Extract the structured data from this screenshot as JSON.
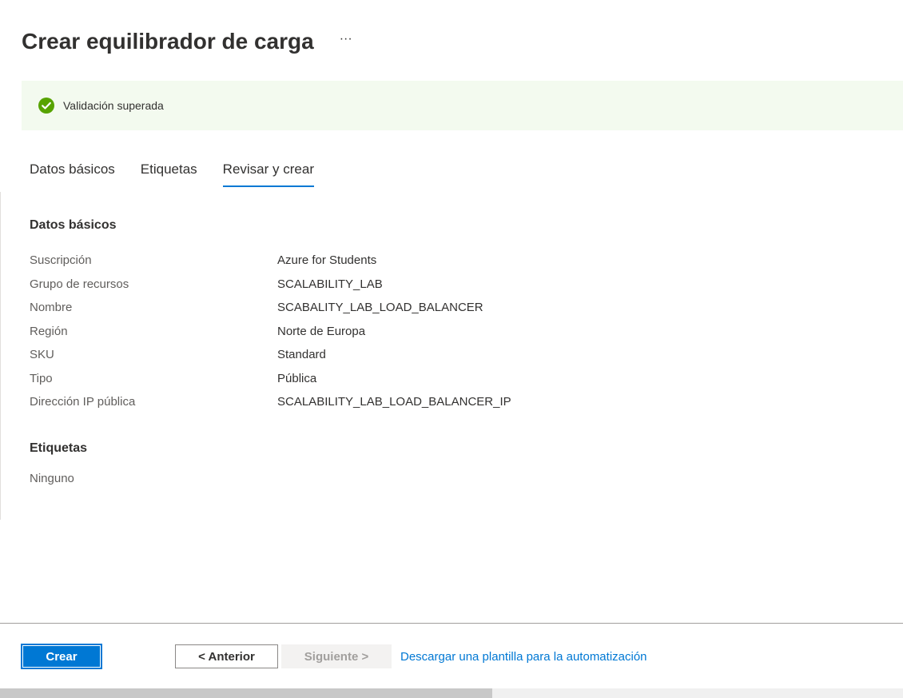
{
  "header": {
    "title": "Crear equilibrador de carga",
    "more_label": "···"
  },
  "banner": {
    "icon": "check-circle-icon",
    "text": "Validación superada",
    "color": "#57a300"
  },
  "tabs": [
    {
      "label": "Datos básicos",
      "active": false
    },
    {
      "label": "Etiquetas",
      "active": false
    },
    {
      "label": "Revisar y crear",
      "active": true
    }
  ],
  "basics": {
    "title": "Datos básicos",
    "rows": [
      {
        "label": "Suscripción",
        "value": "Azure for Students"
      },
      {
        "label": "Grupo de recursos",
        "value": "SCALABILITY_LAB"
      },
      {
        "label": "Nombre",
        "value": "SCABALITY_LAB_LOAD_BALANCER"
      },
      {
        "label": "Región",
        "value": "Norte de Europa"
      },
      {
        "label": "SKU",
        "value": "Standard"
      },
      {
        "label": "Tipo",
        "value": "Pública"
      },
      {
        "label": "Dirección IP pública",
        "value": "SCALABILITY_LAB_LOAD_BALANCER_IP"
      }
    ]
  },
  "tags": {
    "title": "Etiquetas",
    "none_text": "Ninguno"
  },
  "footer": {
    "create_label": "Crear",
    "previous_label": "< Anterior",
    "next_label": "Siguiente >",
    "download_link": "Descargar una plantilla para la automatización"
  },
  "colors": {
    "accent": "#0078d4",
    "success_bg": "#f3faef"
  }
}
